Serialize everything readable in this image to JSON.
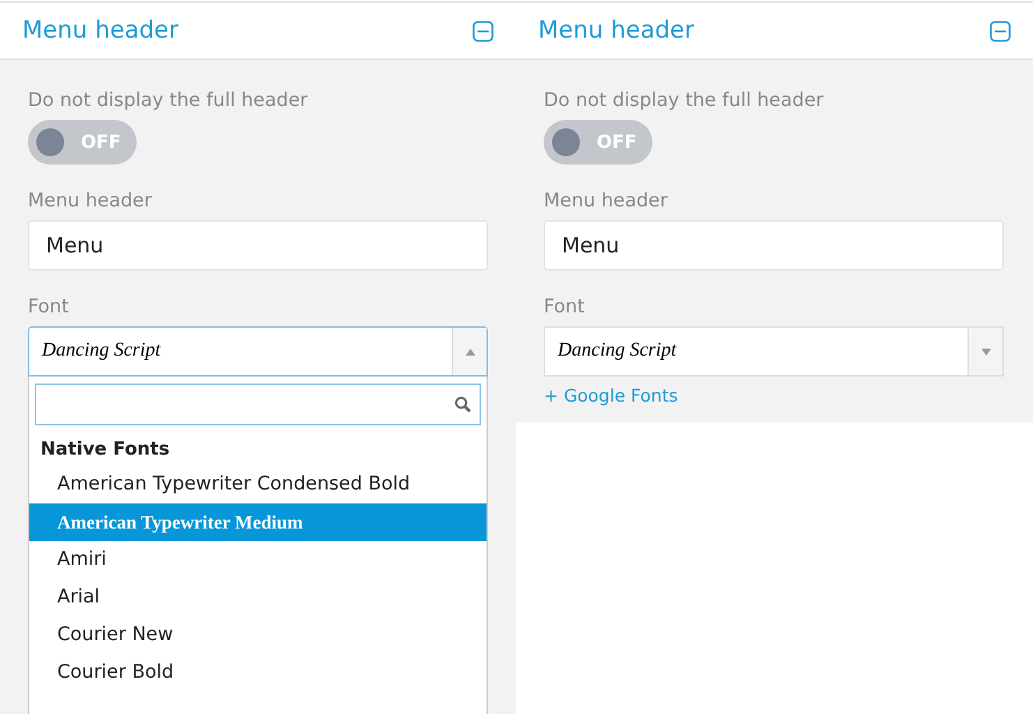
{
  "panels": [
    {
      "title": "Menu header",
      "toggle": {
        "label": "Do not display the full header",
        "on": false,
        "text": "OFF"
      },
      "name_field": {
        "label": "Menu header",
        "value": "Menu"
      },
      "font": {
        "label": "Font",
        "value": "Dancing Script",
        "open": true,
        "group": "Native Fonts",
        "options": [
          {
            "label": "American Typewriter Condensed Bold",
            "selected": false
          },
          {
            "label": "American Typewriter Medium",
            "selected": true
          },
          {
            "label": "Amiri",
            "selected": false
          },
          {
            "label": "Arial",
            "selected": false
          },
          {
            "label": "Courier New",
            "selected": false
          },
          {
            "label": "Courier Bold",
            "selected": false
          }
        ]
      }
    },
    {
      "title": "Menu header",
      "toggle": {
        "label": "Do not display the full header",
        "on": false,
        "text": "OFF"
      },
      "name_field": {
        "label": "Menu header",
        "value": "Menu"
      },
      "font": {
        "label": "Font",
        "value": "Dancing Script",
        "open": false
      },
      "link": "+ Google Fonts"
    }
  ]
}
